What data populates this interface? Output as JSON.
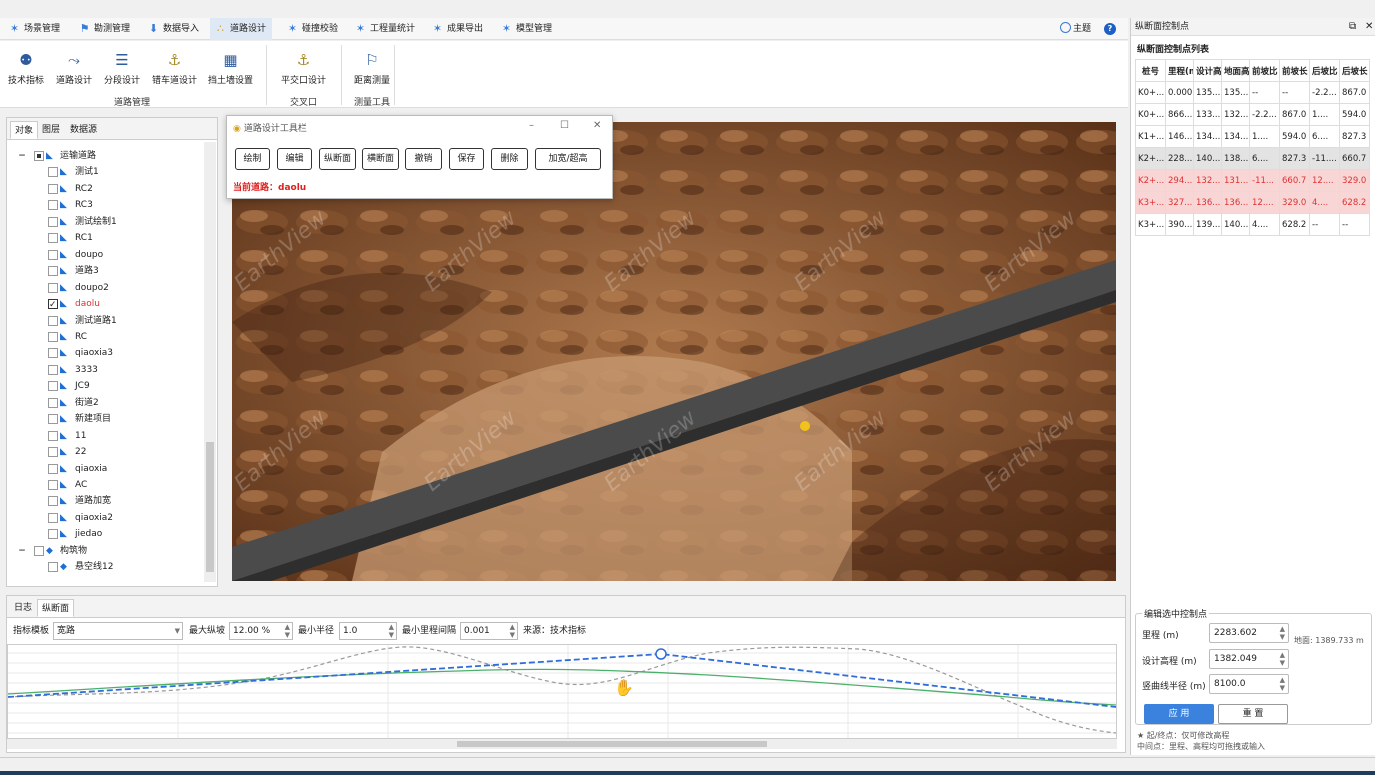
{
  "menu": [
    {
      "label": "场景管理",
      "icon": "module-icon"
    },
    {
      "label": "勘测管理",
      "icon": "survey-icon"
    },
    {
      "label": "数据导入",
      "icon": "import-icon"
    },
    {
      "label": "道路设计",
      "icon": "road-icon",
      "active": true
    },
    {
      "label": "碰撞校验",
      "icon": "collision-icon"
    },
    {
      "label": "工程量统计",
      "icon": "stats-icon"
    },
    {
      "label": "成果导出",
      "icon": "export-icon"
    },
    {
      "label": "模型管理",
      "icon": "model-icon"
    }
  ],
  "theme_label": "主题",
  "help_label": "?",
  "ribbon": {
    "buttons": [
      {
        "label": "技术指标",
        "icon": "binoculars-icon"
      },
      {
        "label": "道路设计",
        "icon": "road-design-icon"
      },
      {
        "label": "分段设计",
        "icon": "segment-icon"
      },
      {
        "label": "错车道设计",
        "icon": "passing-bay-icon"
      },
      {
        "label": "挡土墙设置",
        "icon": "retaining-wall-icon"
      },
      {
        "label": "平交口设计",
        "icon": "intersection-icon"
      },
      {
        "label": "距离测量",
        "icon": "measure-icon"
      }
    ],
    "groups": [
      "道路管理",
      "交叉口",
      "测量工具"
    ]
  },
  "left_tabs": [
    "对象",
    "图层",
    "数据源"
  ],
  "tree": [
    {
      "label": "运输道路",
      "level": 0,
      "expand": "−",
      "check": "ind",
      "icon": "road-icon"
    },
    {
      "label": "测试1",
      "level": 1,
      "check": "none",
      "icon": "road-icon"
    },
    {
      "label": "RC2",
      "level": 1,
      "check": "none",
      "icon": "road-icon"
    },
    {
      "label": "RC3",
      "level": 1,
      "check": "none",
      "icon": "road-icon"
    },
    {
      "label": "测试绘制1",
      "level": 1,
      "check": "none",
      "icon": "road-icon"
    },
    {
      "label": "RC1",
      "level": 1,
      "check": "none",
      "icon": "road-icon"
    },
    {
      "label": "doupo",
      "level": 1,
      "check": "none",
      "icon": "road-icon"
    },
    {
      "label": "道路3",
      "level": 1,
      "check": "none",
      "icon": "road-icon"
    },
    {
      "label": "doupo2",
      "level": 1,
      "check": "none",
      "icon": "road-icon"
    },
    {
      "label": "daolu",
      "level": 1,
      "check": "chk",
      "icon": "road-icon",
      "red": true
    },
    {
      "label": "测试道路1",
      "level": 1,
      "check": "none",
      "icon": "road-icon"
    },
    {
      "label": "RC",
      "level": 1,
      "check": "none",
      "icon": "road-icon"
    },
    {
      "label": "qiaoxia3",
      "level": 1,
      "check": "none",
      "icon": "road-icon"
    },
    {
      "label": "3333",
      "level": 1,
      "check": "none",
      "icon": "road-icon"
    },
    {
      "label": "JC9",
      "level": 1,
      "check": "none",
      "icon": "road-icon"
    },
    {
      "label": "街道2",
      "level": 1,
      "check": "none",
      "icon": "road-icon"
    },
    {
      "label": "新建项目",
      "level": 1,
      "check": "none",
      "icon": "road-icon"
    },
    {
      "label": "11",
      "level": 1,
      "check": "none",
      "icon": "road-icon"
    },
    {
      "label": "22",
      "level": 1,
      "check": "none",
      "icon": "road-icon"
    },
    {
      "label": "qiaoxia",
      "level": 1,
      "check": "none",
      "icon": "road-icon"
    },
    {
      "label": "AC",
      "level": 1,
      "check": "none",
      "icon": "road-icon"
    },
    {
      "label": "道路加宽",
      "level": 1,
      "check": "none",
      "icon": "road-icon"
    },
    {
      "label": "qiaoxia2",
      "level": 1,
      "check": "none",
      "icon": "road-icon"
    },
    {
      "label": "jiedao",
      "level": 1,
      "check": "none",
      "icon": "road-icon"
    },
    {
      "label": "构筑物",
      "level": 0,
      "expand": "−",
      "check": "none",
      "icon": "structure-icon"
    },
    {
      "label": "悬空线12",
      "level": 1,
      "check": "none",
      "icon": "structure-icon"
    }
  ],
  "toolwin": {
    "title": "道路设计工具栏",
    "buttons": [
      "绘制",
      "编辑",
      "纵断面",
      "横断面",
      "撤销",
      "保存",
      "删除",
      "加宽/超高"
    ],
    "current_road": "当前道路：daolu"
  },
  "watermark": "EarthView",
  "bottom_tabs": [
    "日志",
    "纵断面"
  ],
  "profile_bar": {
    "template_label": "指标模板",
    "template_value": "宽路",
    "max_grade_label": "最大纵坡",
    "max_grade_value": "12.00 %",
    "min_radius_label": "最小半径",
    "min_radius_value": "1.0",
    "min_interval_label": "最小里程间隔",
    "min_interval_value": "0.001",
    "source_label": "来源：技术指标"
  },
  "right_panel": {
    "title": "纵断面控制点",
    "list_title": "纵断面控制点列表",
    "columns": [
      "桩号",
      "里程(m",
      "设计高程",
      "地面高程",
      "前坡比",
      "前坡长",
      "后坡比",
      "后坡长"
    ],
    "rows": [
      {
        "cells": [
          "K0+...",
          "0.000",
          "135...",
          "135...",
          "--",
          "--",
          "-2.2...",
          "867.0"
        ],
        "state": ""
      },
      {
        "cells": [
          "K0+...",
          "866....",
          "133...",
          "132...",
          "-2.2...",
          "867.0",
          "1....",
          "594.0"
        ],
        "state": ""
      },
      {
        "cells": [
          "K1+...",
          "146...",
          "134...",
          "134...",
          "1....",
          "594.0",
          "6....",
          "827.3"
        ],
        "state": ""
      },
      {
        "cells": [
          "K2+...",
          "228...",
          "140...",
          "138...",
          "6....",
          "827.3",
          "-11....",
          "660.7"
        ],
        "state": "sel"
      },
      {
        "cells": [
          "K2+...",
          "294...",
          "132...",
          "131...",
          "-11...",
          "660.7",
          "12....",
          "329.0"
        ],
        "state": "hl"
      },
      {
        "cells": [
          "K3+...",
          "327...",
          "136...",
          "136...",
          "12....",
          "329.0",
          "4....",
          "628.2"
        ],
        "state": "hl"
      },
      {
        "cells": [
          "K3+...",
          "390...",
          "139...",
          "140...",
          "4....",
          "628.2",
          "--",
          "--"
        ],
        "state": ""
      }
    ],
    "edit_title": "编辑选中控制点",
    "mileage_label": "里程 (m)",
    "mileage_value": "2283.602",
    "ground_label": "地面: 1389.733 m",
    "elev_label": "设计高程 (m)",
    "elev_value": "1382.049",
    "radius_label": "竖曲线半径 (m)",
    "radius_value": "8100.0",
    "apply_label": "应 用",
    "reset_label": "重 置",
    "note1": "★ 起/终点：仅可修改高程",
    "note2": "中间点：里程、高程均可拖拽或输入"
  }
}
